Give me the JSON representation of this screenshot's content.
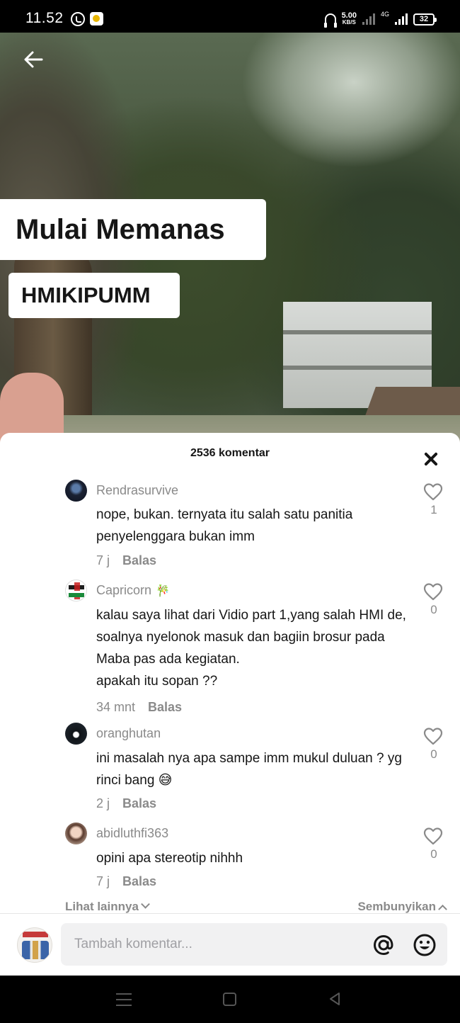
{
  "status_bar": {
    "time": "11.52",
    "net_speed_value": "5.00",
    "net_speed_unit": "KB/S",
    "network_type": "4G",
    "battery": "32"
  },
  "video": {
    "caption_title": "Mulai Memanas",
    "caption_tag": "HMIKIPUMM"
  },
  "comments_sheet": {
    "title": "2536 komentar",
    "reply_label": "Balas",
    "comments": [
      {
        "username": "Rendrasurvive",
        "text": "nope, bukan. ternyata itu salah satu panitia penyelenggara bukan imm",
        "time": "7 j",
        "likes": "1"
      },
      {
        "username": "Capricorn",
        "emoji": "🎋",
        "text": "kalau saya lihat dari Vidio part 1,yang salah HMI de, soalnya nyelonok masuk dan bagiin brosur pada Maba pas ada kegiatan.\napakah itu sopan ??",
        "time": "34 mnt",
        "likes": "0"
      },
      {
        "username": "oranghutan",
        "text": "ini masalah nya apa sampe imm mukul duluan ? yg rinci bang 😅",
        "time": "2 j",
        "likes": "0"
      },
      {
        "username": "abidluthfi363",
        "text": "opini apa stereotip nihhh",
        "time": "7 j",
        "likes": "0"
      }
    ],
    "view_more_label": "Lihat lainnya",
    "hide_label": "Sembunyikan"
  },
  "composer": {
    "placeholder": "Tambah komentar..."
  },
  "colors": {
    "text_primary": "#161616",
    "text_secondary": "#8a8a8a",
    "input_bg": "#f1f1f2"
  }
}
